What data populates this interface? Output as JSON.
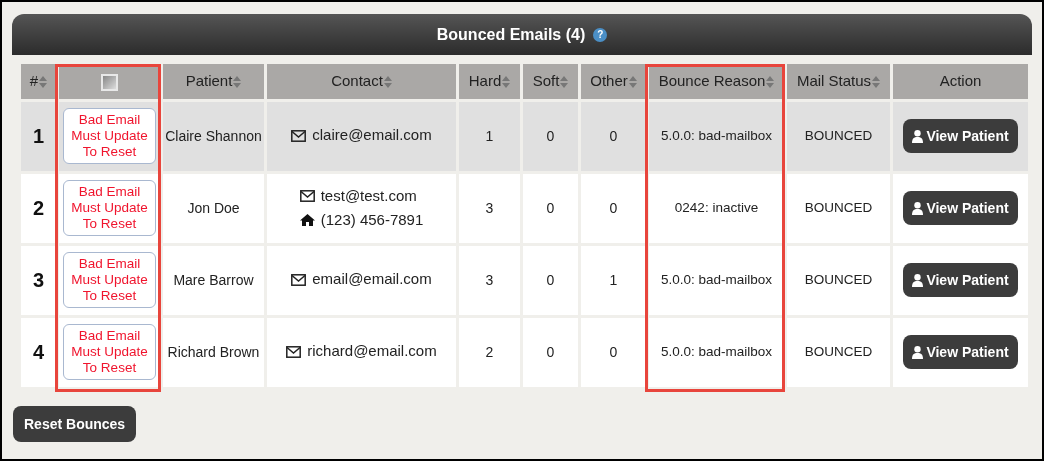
{
  "panel": {
    "title": "Bounced Emails (4)",
    "help": "?"
  },
  "table": {
    "columns": [
      {
        "label": "#",
        "sortable": true,
        "highlighted": false
      },
      {
        "kind": "checkbox",
        "checked": false,
        "highlighted": true
      },
      {
        "label": "Patient",
        "sortable": true,
        "highlighted": false
      },
      {
        "label": "Contact",
        "sortable": true,
        "highlighted": false
      },
      {
        "label": "Hard",
        "sortable": true,
        "highlighted": false
      },
      {
        "label": "Soft",
        "sortable": true,
        "highlighted": false
      },
      {
        "label": "Other",
        "sortable": true,
        "highlighted": false
      },
      {
        "label": "Bounce Reason",
        "sortable": true,
        "highlighted": true
      },
      {
        "label": "Mail Status",
        "sortable": true,
        "highlighted": false
      },
      {
        "label": "Action",
        "sortable": false,
        "highlighted": false
      }
    ],
    "rows": [
      {
        "selected": true,
        "number": "1",
        "reset_note": "Bad Email Must Update To Reset",
        "patient": "Claire Shannon",
        "contact": [
          {
            "kind": "email",
            "text": "claire@email.com"
          }
        ],
        "hard": "1",
        "soft": "0",
        "other": "0",
        "bounce_reason": "5.0.0: bad-mailbox",
        "mail_status": "BOUNCED",
        "action": "View Patient"
      },
      {
        "selected": false,
        "number": "2",
        "reset_note": "Bad Email Must Update To Reset",
        "patient": "Jon Doe",
        "contact": [
          {
            "kind": "email",
            "text": "test@test.com"
          },
          {
            "kind": "phone",
            "text": "(123) 456-7891"
          }
        ],
        "hard": "3",
        "soft": "0",
        "other": "0",
        "bounce_reason": "0242: inactive",
        "mail_status": "BOUNCED",
        "action": "View Patient"
      },
      {
        "selected": false,
        "number": "3",
        "reset_note": "Bad Email Must Update To Reset",
        "patient": "Mare Barrow",
        "contact": [
          {
            "kind": "email",
            "text": "email@email.com"
          }
        ],
        "hard": "3",
        "soft": "0",
        "other": "1",
        "bounce_reason": "5.0.0: bad-mailbox",
        "mail_status": "BOUNCED",
        "action": "View Patient"
      },
      {
        "selected": false,
        "number": "4",
        "reset_note": "Bad Email Must Update To Reset",
        "patient": "Richard Brown",
        "contact": [
          {
            "kind": "email",
            "text": "richard@email.com"
          }
        ],
        "hard": "2",
        "soft": "0",
        "other": "0",
        "bounce_reason": "5.0.0: bad-mailbox",
        "mail_status": "BOUNCED",
        "action": "View Patient"
      }
    ]
  },
  "footer_button": "Reset Bounces"
}
